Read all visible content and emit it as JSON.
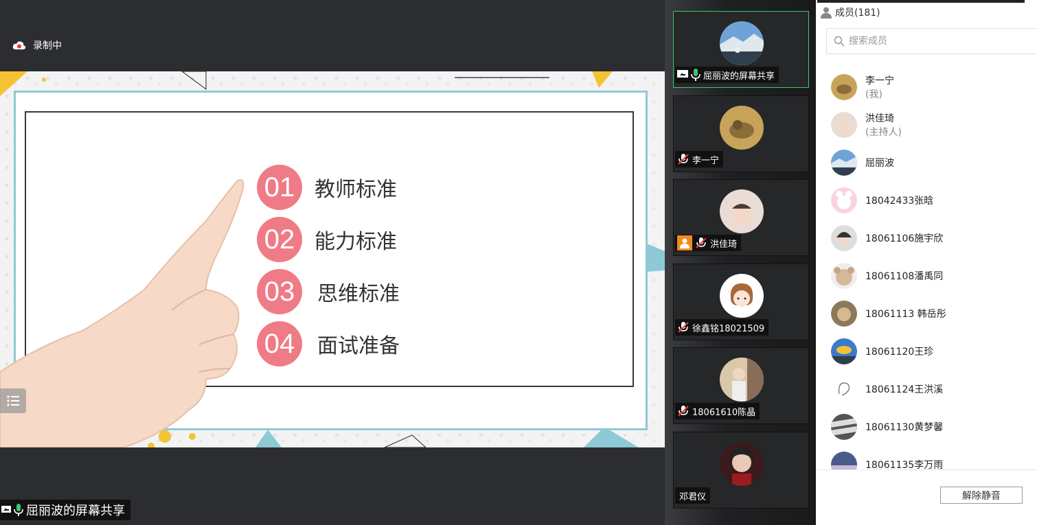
{
  "recording": {
    "label": "录制中"
  },
  "slide": {
    "items": [
      {
        "num": "01",
        "label": "教师标准"
      },
      {
        "num": "02",
        "label": "能力标准"
      },
      {
        "num": "03",
        "label": "思维标准"
      },
      {
        "num": "04",
        "label": "面试准备"
      }
    ],
    "accent_color": "#ef7b87"
  },
  "share_label": "屈丽波的屏幕共享",
  "video_tiles": [
    {
      "name": "屈丽波的屏幕共享",
      "mic": "on",
      "sharing": true,
      "active": true
    },
    {
      "name": "李一宁",
      "mic": "muted"
    },
    {
      "name": "洪佳琦",
      "mic": "muted",
      "host": true
    },
    {
      "name": "徐鑫铭18021509",
      "mic": "muted"
    },
    {
      "name": "18061610陈晶",
      "mic": "muted"
    },
    {
      "name": "邓君仪",
      "mic": "none"
    }
  ],
  "members": {
    "header": "成员(181)",
    "search_placeholder": "搜索成员",
    "list": [
      {
        "name": "李一宁",
        "role": "(我)"
      },
      {
        "name": "洪佳琦",
        "role": "(主持人)"
      },
      {
        "name": "屈丽波",
        "role": ""
      },
      {
        "name": "18042433张晗",
        "role": ""
      },
      {
        "name": "18061106施宇欣",
        "role": ""
      },
      {
        "name": "18061108潘禹同",
        "role": ""
      },
      {
        "name": "18061113 韩岳彤",
        "role": ""
      },
      {
        "name": "18061120王珍",
        "role": ""
      },
      {
        "name": "18061124王洪溪",
        "role": ""
      },
      {
        "name": "18061130黄梦馨",
        "role": ""
      },
      {
        "name": "18061135李万雨",
        "role": ""
      }
    ],
    "unmute_label": "解除静音"
  }
}
